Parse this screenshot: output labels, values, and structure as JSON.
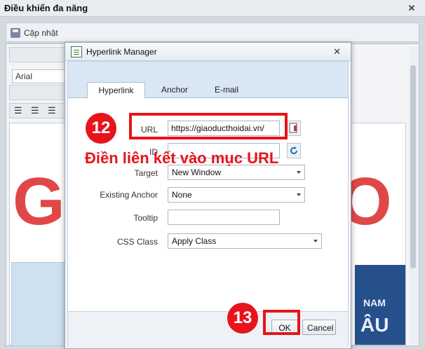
{
  "window": {
    "title": "Điều khiển đa năng",
    "close_glyph": "✕",
    "update_label": "Cập nhật",
    "update_icon": "save-icon"
  },
  "editor": {
    "font_name": "Arial",
    "background_letters": [
      "G",
      "O"
    ],
    "background_words": [
      "NAM",
      "ÂU"
    ]
  },
  "dialog": {
    "title": "Hyperlink Manager",
    "close_glyph": "✕",
    "tabs": [
      {
        "label": "Hyperlink",
        "active": true
      },
      {
        "label": "Anchor",
        "active": false
      },
      {
        "label": "E-mail",
        "active": false
      }
    ],
    "fields": {
      "url": {
        "label": "URL",
        "value": "https://giaoducthoidai.vn/"
      },
      "id": {
        "label": "ID",
        "value": ""
      },
      "target": {
        "label": "Target",
        "value": "New Window"
      },
      "existing_anchor": {
        "label": "Existing Anchor",
        "value": "None"
      },
      "tooltip": {
        "label": "Tooltip",
        "value": ""
      },
      "css_class": {
        "label": "CSS Class",
        "value": "Apply Class"
      }
    },
    "buttons": {
      "ok": "OK",
      "cancel": "Cancel"
    }
  },
  "annotations": {
    "step12": "12",
    "step13": "13",
    "instruction": "Điền liên kết vào mục URL",
    "color": "#e8141b"
  }
}
